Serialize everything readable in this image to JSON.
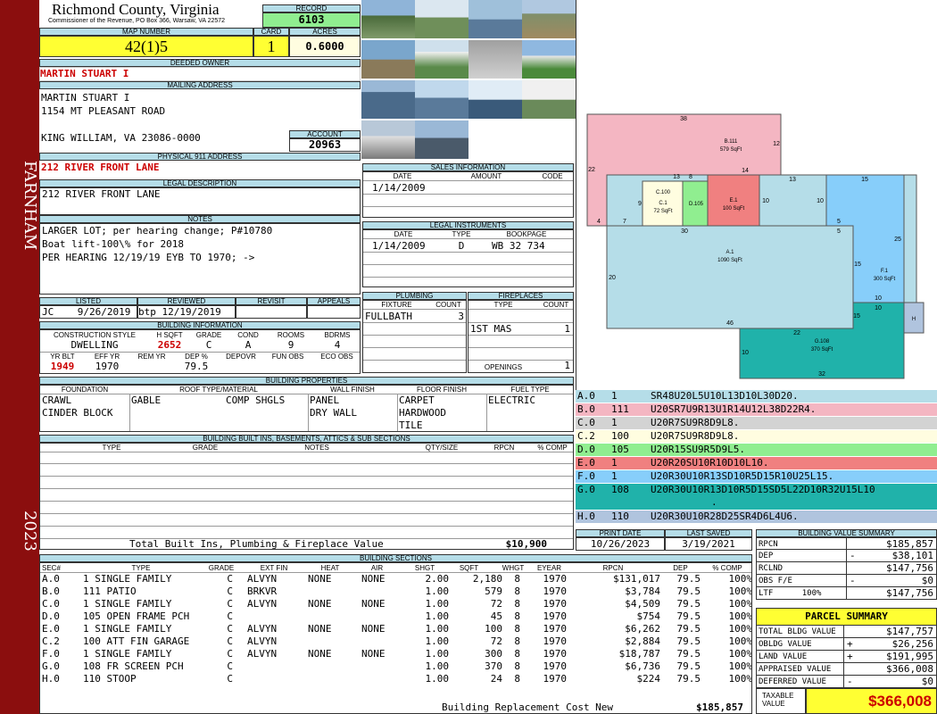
{
  "sidebar": {
    "name": "FARNHAM",
    "year": "2023"
  },
  "header": {
    "county": "Richmond County, Virginia",
    "commissioner": "Commissioner of the Revenue, PO Box 366, Warsaw, VA 22572",
    "record_label": "RECORD",
    "record": "6103",
    "map_label": "MAP NUMBER",
    "map": "42(1)5",
    "card_label": "CARD",
    "card": "1",
    "acres_label": "ACRES",
    "acres": "0.6000"
  },
  "owner": {
    "deeded_label": "DEEDED OWNER",
    "deeded": "MARTIN STUART I",
    "mailing_label": "MAILING ADDRESS",
    "lines": [
      "MARTIN STUART I",
      "1154 MT PLEASANT ROAD",
      "",
      "KING WILLIAM, VA 23086-0000"
    ],
    "account_label": "ACCOUNT",
    "account": "20963"
  },
  "physical": {
    "label": "PHYSICAL 911 ADDRESS",
    "value": "212 RIVER FRONT LANE"
  },
  "legal": {
    "label": "LEGAL DESCRIPTION",
    "value": "212 RIVER FRONT LANE"
  },
  "notes": {
    "label": "NOTES",
    "lines": [
      "LARGER LOT; per hearing change; P#10780",
      "Boat lift-100\\% for 2018",
      "PER HEARING 12/19/19 EYB TO 1970; ->"
    ]
  },
  "listed": {
    "h": [
      "LISTED",
      "REVIEWED",
      "REVISIT",
      "APPEALS"
    ],
    "listed": "JC    9/26/2019",
    "reviewed": "btp 12/19/2019"
  },
  "building_info": {
    "label": "BUILDING INFORMATION",
    "h1": [
      "CONSTRUCTION STYLE",
      "H SQFT",
      "GRADE",
      "COND",
      "ROOMS",
      "BDRMS"
    ],
    "v1": [
      "DWELLING",
      "2652",
      "C",
      "A",
      "9",
      "4"
    ],
    "h2": [
      "YR BLT",
      "EFF YR",
      "REM YR",
      "DEP %",
      "DEPOVR",
      "FUN OBS",
      "ECO OBS"
    ],
    "v2": [
      "1949",
      "1970",
      "",
      "79.5",
      "",
      "",
      ""
    ]
  },
  "sales": {
    "label": "SALES INFORMATION",
    "h": [
      "DATE",
      "AMOUNT",
      "CODE"
    ],
    "rows": [
      [
        "1/14/2009",
        "",
        ""
      ]
    ]
  },
  "instruments": {
    "label": "LEGAL INSTRUMENTS",
    "h": [
      "DATE",
      "TYPE",
      "BOOKPAGE"
    ],
    "rows": [
      [
        "1/14/2009",
        "D",
        "WB 32 734"
      ]
    ]
  },
  "plumbing": {
    "label": "PLUMBING",
    "h": [
      "FIXTURE",
      "COUNT"
    ],
    "rows": [
      [
        "FULLBATH",
        "3"
      ]
    ]
  },
  "fireplaces": {
    "label": "FIREPLACES",
    "h": [
      "TYPE",
      "COUNT"
    ],
    "rows": [
      [
        "1ST MAS",
        "1"
      ]
    ],
    "openings_label": "OPENINGS",
    "openings": "1"
  },
  "properties": {
    "label": "BUILDING PROPERTIES",
    "h": [
      "FOUNDATION",
      "ROOF TYPE/MATERIAL",
      "WALL FINISH",
      "FLOOR FINISH",
      "FUEL TYPE"
    ],
    "foundation": [
      "CRAWL",
      "CINDER BLOCK"
    ],
    "roof": [
      "GABLE           COMP SHGLS"
    ],
    "wall": [
      "PANEL",
      "DRY WALL"
    ],
    "floor": [
      "CARPET",
      "HARDWOOD",
      "TILE"
    ],
    "fuel": [
      "ELECTRIC"
    ]
  },
  "builtins": {
    "label": "BUILDING BUILT INS, BASEMENTS, ATTICS & SUB SECTIONS",
    "h": [
      "TYPE",
      "GRADE",
      "NOTES",
      "QTY/SIZE",
      "RPCN",
      "% COMP"
    ],
    "total_label": "Total Built Ins, Plumbing & Fireplace Value",
    "total": "$10,900"
  },
  "sections": {
    "label": "BUILDING SECTIONS",
    "h": [
      "SEC#",
      "TYPE",
      "GRADE",
      "EXT FIN",
      "HEAT",
      "AIR",
      "SHGT",
      "SQFT",
      "WHGT",
      "EYEAR",
      "RPCN",
      "DEP",
      "% COMP"
    ],
    "rows": [
      [
        "A.0",
        "1 SINGLE FAMILY",
        "C",
        "ALVYN",
        "NONE",
        "NONE",
        "2.00",
        "2,180",
        "8",
        "1970",
        "$131,017",
        "79.5",
        "100%"
      ],
      [
        "B.0",
        "111 PATIO",
        "C",
        "BRKVR",
        "",
        "",
        "1.00",
        "579",
        "8",
        "1970",
        "$3,784",
        "79.5",
        "100%"
      ],
      [
        "C.0",
        "1 SINGLE FAMILY",
        "C",
        "ALVYN",
        "NONE",
        "NONE",
        "1.00",
        "72",
        "8",
        "1970",
        "$4,509",
        "79.5",
        "100%"
      ],
      [
        "D.0",
        "105 OPEN FRAME PCH",
        "C",
        "",
        "",
        "",
        "1.00",
        "45",
        "8",
        "1970",
        "$754",
        "79.5",
        "100%"
      ],
      [
        "E.0",
        "1 SINGLE FAMILY",
        "C",
        "ALVYN",
        "NONE",
        "NONE",
        "1.00",
        "100",
        "8",
        "1970",
        "$6,262",
        "79.5",
        "100%"
      ],
      [
        "C.2",
        "100 ATT FIN GARAGE",
        "C",
        "ALVYN",
        "",
        "",
        "1.00",
        "72",
        "8",
        "1970",
        "$2,884",
        "79.5",
        "100%"
      ],
      [
        "F.0",
        "1 SINGLE FAMILY",
        "C",
        "ALVYN",
        "NONE",
        "NONE",
        "1.00",
        "300",
        "8",
        "1970",
        "$18,787",
        "79.5",
        "100%"
      ],
      [
        "G.0",
        "108 FR SCREEN PCH",
        "C",
        "",
        "",
        "",
        "1.00",
        "370",
        "8",
        "1970",
        "$6,736",
        "79.5",
        "100%"
      ],
      [
        "H.0",
        "110 STOOP",
        "C",
        "",
        "",
        "",
        "1.00",
        "24",
        "8",
        "1970",
        "$224",
        "79.5",
        "100%"
      ]
    ],
    "total_label": "Building Replacement Cost New",
    "total": "$185,857"
  },
  "sketch": {
    "areas": [
      {
        "id": "B.111",
        "sqft": "579 SqFt"
      },
      {
        "id": "C.100",
        "sub": "C.1",
        "sqft": "72 SqFt"
      },
      {
        "id": "D.105"
      },
      {
        "id": "E.1",
        "sqft": "100 SqFt"
      },
      {
        "id": "A.1",
        "sqft": "1090 SqFt"
      },
      {
        "id": "F.1",
        "sqft": "300 SqFt"
      },
      {
        "id": "G.108",
        "sqft": "370 SqFt"
      },
      {
        "id": "H"
      }
    ],
    "dims": [
      "38",
      "12",
      "22",
      "4",
      "7",
      "13",
      "14",
      "9",
      "8",
      "10",
      "30",
      "13",
      "10",
      "15",
      "5",
      "5",
      "25",
      "20",
      "15",
      "10",
      "46",
      "22",
      "32",
      "10",
      "10",
      "15"
    ]
  },
  "legend": [
    {
      "sec": "A.0",
      "code": "1",
      "path": "SR48U20L5U10L13D10L30D20.",
      "color": "#b5dde8"
    },
    {
      "sec": "B.0",
      "code": "111",
      "path": "U20SR7U9R13U1R14U12L38D22R4.",
      "color": "#f4b6c2"
    },
    {
      "sec": "C.0",
      "code": "1",
      "path": "U20R7SU9R8D9L8.",
      "color": "#d3d3d3"
    },
    {
      "sec": "C.2",
      "code": "100",
      "path": "U20R7SU9R8D9L8.",
      "color": "#fffde0"
    },
    {
      "sec": "D.0",
      "code": "105",
      "path": "U20R15SU9R5D9L5.",
      "color": "#90ee90"
    },
    {
      "sec": "E.0",
      "code": "1",
      "path": "U20R20SU10R10D10L10.",
      "color": "#f08080"
    },
    {
      "sec": "F.0",
      "code": "1",
      "path": "U20R30U10R13SD10R5D15R10U25L15.",
      "color": "#87cefa"
    },
    {
      "sec": "G.0",
      "code": "108",
      "path": "U20R30U10R13D10R5D15SD5L22D10R32U15L10",
      "path2": ".",
      "color": "#20b2aa"
    },
    {
      "sec": "H.0",
      "code": "110",
      "path": "U20R30U10R28D25SR4D6L4U6.",
      "color": "#b0c4de"
    }
  ],
  "dates": {
    "print_label": "PRINT DATE",
    "print": "10/26/2023",
    "saved_label": "LAST SAVED",
    "saved": "3/19/2021"
  },
  "value_summary": {
    "label": "BUILDING VALUE SUMMARY",
    "rows": [
      [
        "RPCN",
        "",
        "$185,857"
      ],
      [
        "DEP",
        "-",
        "$38,101"
      ],
      [
        "RCLND",
        "",
        "$147,756"
      ],
      [
        "OBS F/E",
        "-",
        "$0"
      ],
      [
        "LTF      100%",
        "",
        "$147,756"
      ]
    ]
  },
  "parcel": {
    "label": "PARCEL SUMMARY",
    "rows": [
      [
        "TOTAL BLDG VALUE",
        "",
        "$147,757"
      ],
      [
        "OBLDG VALUE",
        "+",
        "$26,256"
      ],
      [
        "LAND VALUE",
        "+",
        "$191,995"
      ],
      [
        "APPRAISED VALUE",
        "",
        "$366,008"
      ],
      [
        "DEFERRED VALUE",
        "-",
        "$0"
      ]
    ],
    "taxable_label": "TAXABLE VALUE",
    "taxable": "$366,008"
  }
}
